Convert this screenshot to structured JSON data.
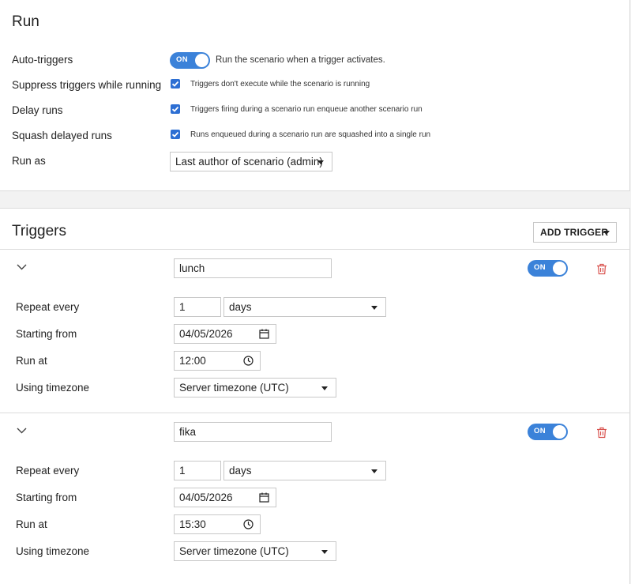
{
  "run": {
    "title": "Run",
    "rows": [
      {
        "label": "Auto-triggers",
        "control": "toggle",
        "toggle_label": "ON",
        "description": "Run the scenario when a trigger activates."
      },
      {
        "label": "Suppress triggers while running",
        "control": "checkbox",
        "checked": true,
        "description": "Triggers don't execute while the scenario is running"
      },
      {
        "label": "Delay runs",
        "control": "checkbox",
        "checked": true,
        "description": "Triggers firing during a scenario run enqueue another scenario run"
      },
      {
        "label": "Squash delayed runs",
        "control": "checkbox",
        "checked": true,
        "description": "Runs enqueued during a scenario run are squashed into a single run"
      },
      {
        "label": "Run as",
        "control": "select",
        "value": "Last author of scenario (admin)"
      }
    ]
  },
  "triggers": {
    "title": "Triggers",
    "add_button_label": "ADD TRIGGER",
    "items": [
      {
        "name": "lunch",
        "toggle_label": "ON",
        "repeat_label": "Repeat every",
        "repeat_value": "1",
        "repeat_unit": "days",
        "start_label": "Starting from",
        "start_value": "04/05/2026",
        "run_at_label": "Run at",
        "run_at_value": "12:00",
        "timezone_label": "Using timezone",
        "timezone_value": "Server timezone (UTC)"
      },
      {
        "name": "fika",
        "toggle_label": "ON",
        "repeat_label": "Repeat every",
        "repeat_value": "1",
        "repeat_unit": "days",
        "start_label": "Starting from",
        "start_value": "04/05/2026",
        "run_at_label": "Run at",
        "run_at_value": "15:30",
        "timezone_label": "Using timezone",
        "timezone_value": "Server timezone (UTC)"
      }
    ]
  },
  "icons": {
    "collapse": "chevron-down-icon",
    "delete": "trash-icon",
    "calendar": "calendar-icon",
    "clock": "clock-icon",
    "check": "check-icon"
  },
  "colors": {
    "accent": "#3b82d9",
    "checkbox": "#2d6fd3",
    "danger": "#d9534f"
  }
}
